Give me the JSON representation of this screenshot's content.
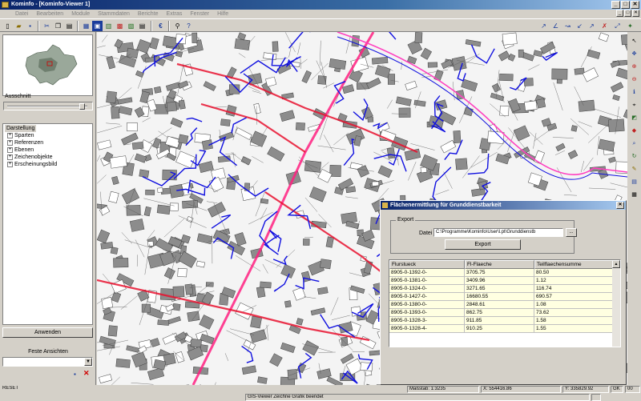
{
  "window": {
    "title": "Kominfo - [Kominfo-Viewer 1]",
    "controls": [
      "_",
      "□",
      "✕"
    ]
  },
  "menu": [
    "Datei",
    "Bearbeiten",
    "Module",
    "Stammdaten",
    "Berichte",
    "Extras",
    "Fenster",
    "Hilfe"
  ],
  "mdi_controls": [
    "_",
    "□",
    "✕"
  ],
  "left": {
    "section_label": "Ausschnitt",
    "tree_root": "Darstellung",
    "tree_items": [
      "Sparten",
      "Referenzen",
      "Ebenen",
      "Zeichenobjekte",
      "Erscheinungsbild"
    ],
    "apply_label": "Anwenden",
    "fixed_views_label": "Feste Ansichten",
    "views_value": ""
  },
  "dialog": {
    "title": "Flächenermittlung für Grunddienstbarkeit",
    "close": "✕",
    "export_legend": "Export",
    "datei_label": "Datei",
    "datei_value": "C:\\Programme\\Kominfo\\User\\l.pt\\Grunddienstb",
    "browse_label": "...",
    "export_button": "Export",
    "columns": [
      "Flurstueck",
      "Fl-Flaeche",
      "Teilflaechensumme"
    ],
    "rows": [
      [
        "8905-0-1392-0-",
        "3705.75",
        "80.50"
      ],
      [
        "8905-0-1381-0-",
        "3409.96",
        "1.12"
      ],
      [
        "8905-0-1324-0-",
        "3271.65",
        "116.74"
      ],
      [
        "8905-0-1427-0-",
        "16680.55",
        "690.57"
      ],
      [
        "8905-0-1380-0-",
        "2848.61",
        "1.08"
      ],
      [
        "8905-0-1393-0-",
        "862.75",
        "73.62"
      ],
      [
        "8905-0-1328-3-",
        "911.85",
        "1.58"
      ],
      [
        "8905-0-1328-4-",
        "910.25",
        "1.55"
      ]
    ]
  },
  "status": {
    "reset": "RESET",
    "scale": "Maßstab: 1:3235",
    "x": "X: 554416.86",
    "y": "Y: 335829.92",
    "gk": "GK",
    "gk_value": "00",
    "message": "GIS-Viewer Zeichne Grafik beendet"
  },
  "colors": {
    "title": "#0a246a",
    "sewer_red": "#e8102e",
    "sewer_blue": "#1010e0",
    "grid_bg": "#ffffe1"
  }
}
